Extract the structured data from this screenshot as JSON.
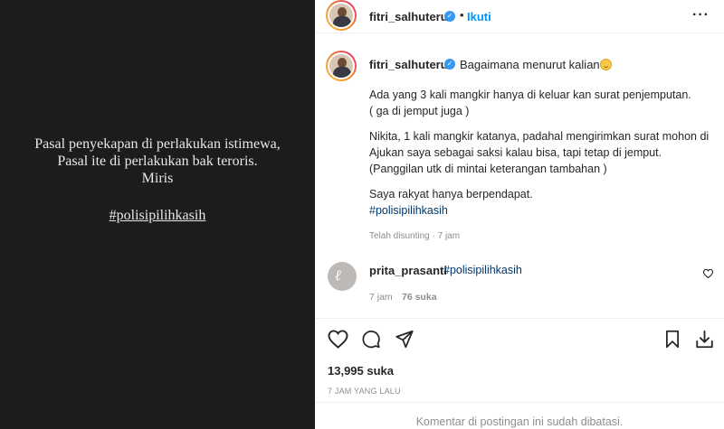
{
  "media": {
    "lines": [
      "Pasal penyekapan di perlakukan istimewa,",
      "Pasal ite di perlakukan bak teroris.",
      "Miris"
    ],
    "hashtag": "#polisipilihkasih"
  },
  "header": {
    "username": "fitri_salhuteru",
    "separator": "•",
    "follow_label": "Ikuti",
    "more_icon": "more-horizontal-icon"
  },
  "caption": {
    "username": "fitri_salhuteru",
    "first_line": "Bagaimana menurut kalian",
    "paragraph1": "Ada yang 3 kali mangkir hanya di keluar kan surat penjemputan.\n( ga di jemput juga )",
    "paragraph2": "Nikita, 1 kali mangkir katanya, padahal mengirimkan surat mohon di Ajukan saya sebagai saksi kalau bisa, tapi tetap di jemput. (Panggilan utk di mintai keterangan tambahan )",
    "paragraph3": "Saya rakyat hanya berpendapat.",
    "hashtag": "#polisipilihkasih",
    "edited": "Telah disunting · 7 jam"
  },
  "comment": {
    "username": "prita_prasanti",
    "text": "#polisipilihkasih",
    "time": "7 jam",
    "likes": "76 suka"
  },
  "actions": {
    "icons": [
      "heart-icon",
      "comment-icon",
      "share-icon",
      "bookmark-icon",
      "download-icon"
    ]
  },
  "stats": {
    "likes": "13,995 suka",
    "time_ago": "7 JAM YANG LALU"
  },
  "footer": {
    "comments_closed": "Komentar di postingan ini sudah dibatasi."
  },
  "colors": {
    "accent": "#0095f6",
    "hashtag": "#00376b",
    "media_bg": "#1c1c1c",
    "muted": "#8e8e8e"
  }
}
